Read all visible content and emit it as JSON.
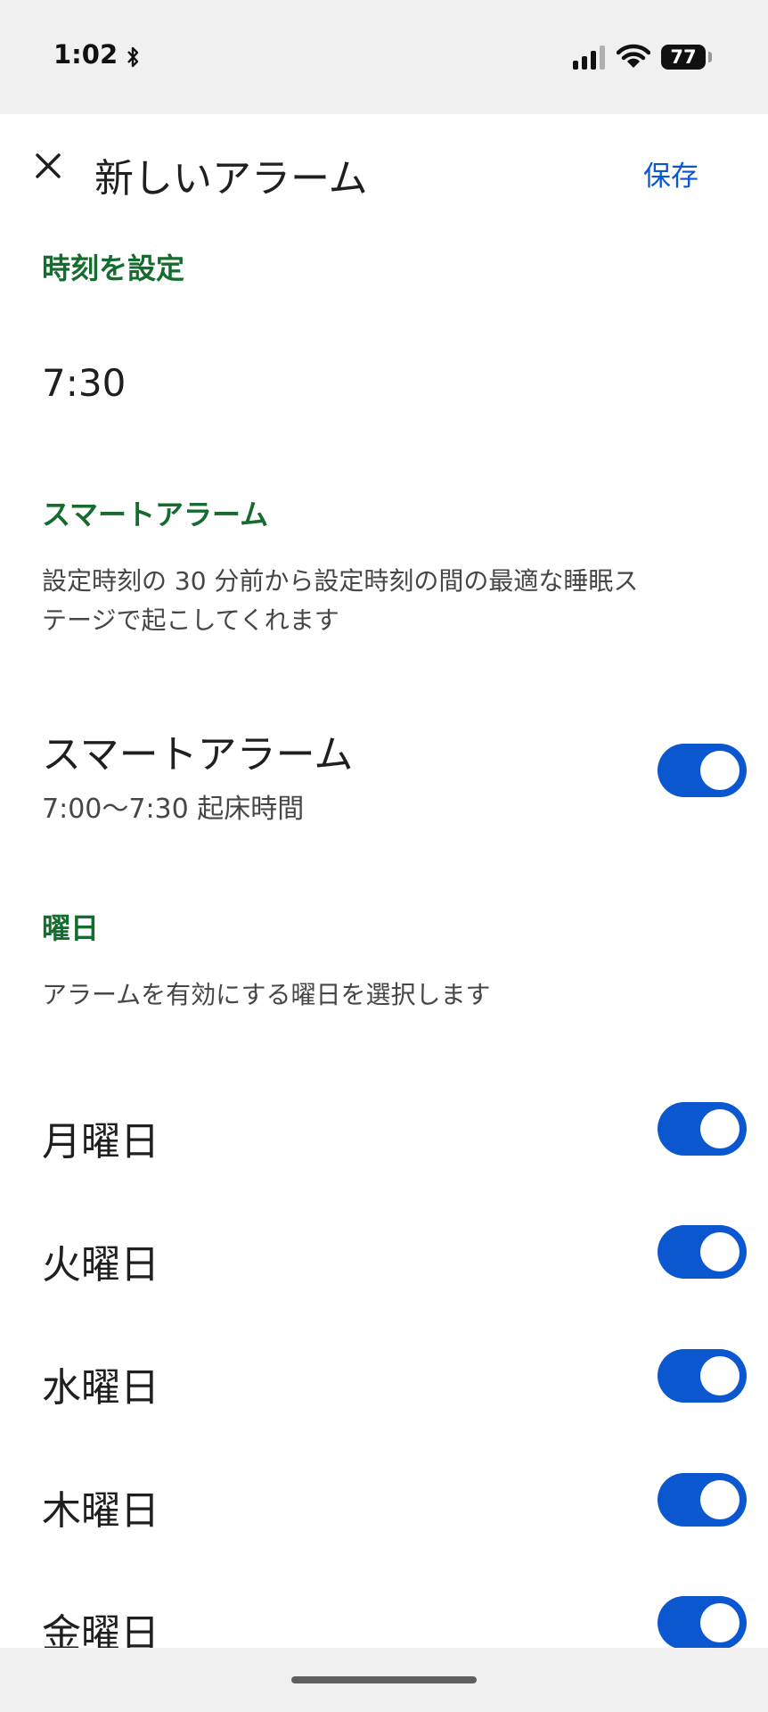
{
  "status_bar": {
    "time": "1:02",
    "battery": "77"
  },
  "header": {
    "title": "新しいアラーム",
    "save_label": "保存",
    "close_icon": "close-icon"
  },
  "time_section": {
    "title": "時刻を設定",
    "time": "7:30"
  },
  "smart_alarm": {
    "section_title": "スマートアラーム",
    "description_line1": "設定時刻の 30 分前から設定時刻の間の最適な睡眠ス",
    "description_line2": "テージで起こしてくれます",
    "row_label": "スマートアラーム",
    "row_sub": "7:00～7:30 起床時間",
    "enabled": true
  },
  "weekdays": {
    "section_title": "曜日",
    "description": "アラームを有効にする曜日を選択します",
    "days": [
      {
        "label": "月曜日",
        "enabled": true
      },
      {
        "label": "火曜日",
        "enabled": true
      },
      {
        "label": "水曜日",
        "enabled": true
      },
      {
        "label": "木曜日",
        "enabled": true
      },
      {
        "label": "金曜日",
        "enabled": true
      }
    ]
  },
  "colors": {
    "accent": "#0b57d0",
    "section_title": "#146c2e"
  }
}
